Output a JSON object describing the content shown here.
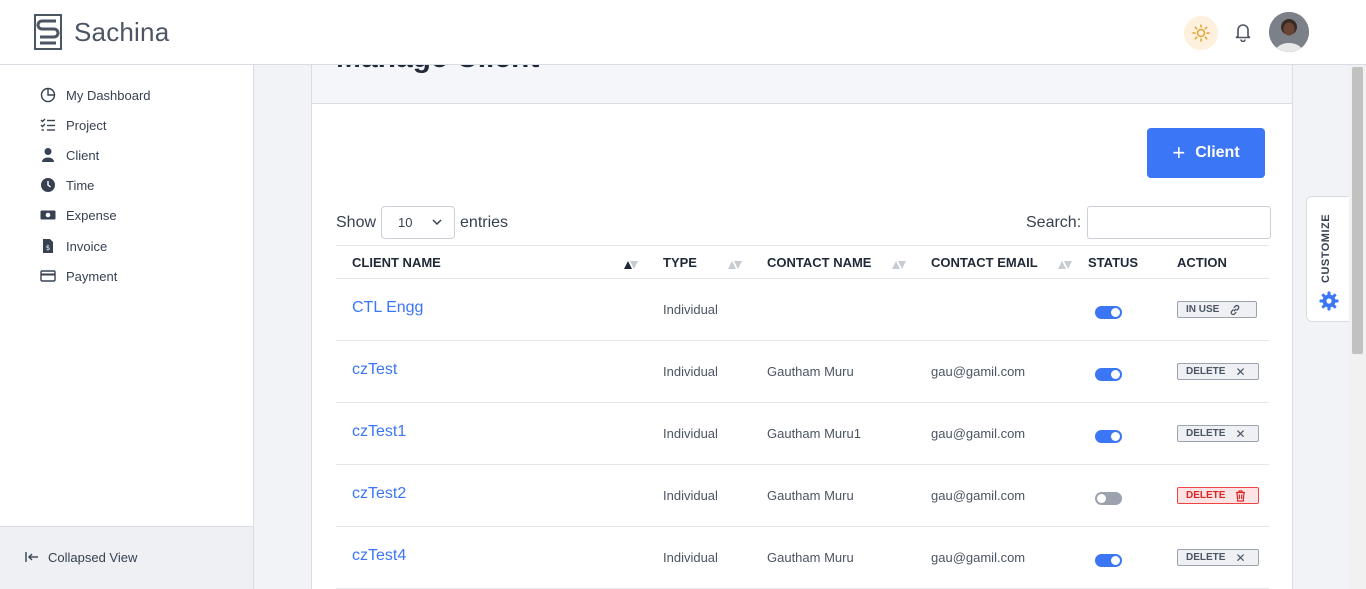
{
  "brand": {
    "name": "Sachina"
  },
  "header": {
    "theme_icon": "sun-icon",
    "notification_icon": "bell-icon"
  },
  "sidebar": {
    "items": [
      {
        "label": "My Dashboard",
        "icon": "pie-chart-icon"
      },
      {
        "label": "Project",
        "icon": "checklist-icon"
      },
      {
        "label": "Client",
        "icon": "user-icon"
      },
      {
        "label": "Time",
        "icon": "clock-icon"
      },
      {
        "label": "Expense",
        "icon": "money-icon"
      },
      {
        "label": "Invoice",
        "icon": "invoice-icon"
      },
      {
        "label": "Payment",
        "icon": "credit-card-icon"
      }
    ],
    "collapse_label": "Collapsed View"
  },
  "page": {
    "title": "Manage Client"
  },
  "toolbar": {
    "add_label": "Client",
    "show_label": "Show",
    "page_length": "10",
    "entries_label": "entries",
    "search_label": "Search:",
    "search_value": ""
  },
  "table": {
    "headers": {
      "client_name": "CLIENT NAME",
      "type": "TYPE",
      "contact_name": "CONTACT NAME",
      "contact_email": "CONTACT EMAIL",
      "status": "STATUS",
      "action": "ACTION"
    },
    "rows": [
      {
        "name": "CTL Engg",
        "type": "Individual",
        "contact": "",
        "email": "",
        "active": true,
        "action": "IN USE",
        "action_icon": "link-icon"
      },
      {
        "name": "czTest",
        "type": "Individual",
        "contact": "Gautham Muru",
        "email": "gau@gamil.com",
        "active": true,
        "action": "DELETE",
        "action_icon": "close-icon"
      },
      {
        "name": "czTest1",
        "type": "Individual",
        "contact": "Gautham Muru1",
        "email": "gau@gamil.com",
        "active": true,
        "action": "DELETE",
        "action_icon": "close-icon"
      },
      {
        "name": "czTest2",
        "type": "Individual",
        "contact": "Gautham Muru",
        "email": "gau@gamil.com",
        "active": false,
        "action": "DELETE",
        "action_icon": "trash-icon"
      },
      {
        "name": "czTest4",
        "type": "Individual",
        "contact": "Gautham Muru",
        "email": "gau@gamil.com",
        "active": true,
        "action": "DELETE",
        "action_icon": "close-icon"
      }
    ]
  },
  "customize": {
    "label": "CUSTOMIZE"
  },
  "colors": {
    "accent": "#3b76f6",
    "danger": "#dc2626"
  }
}
